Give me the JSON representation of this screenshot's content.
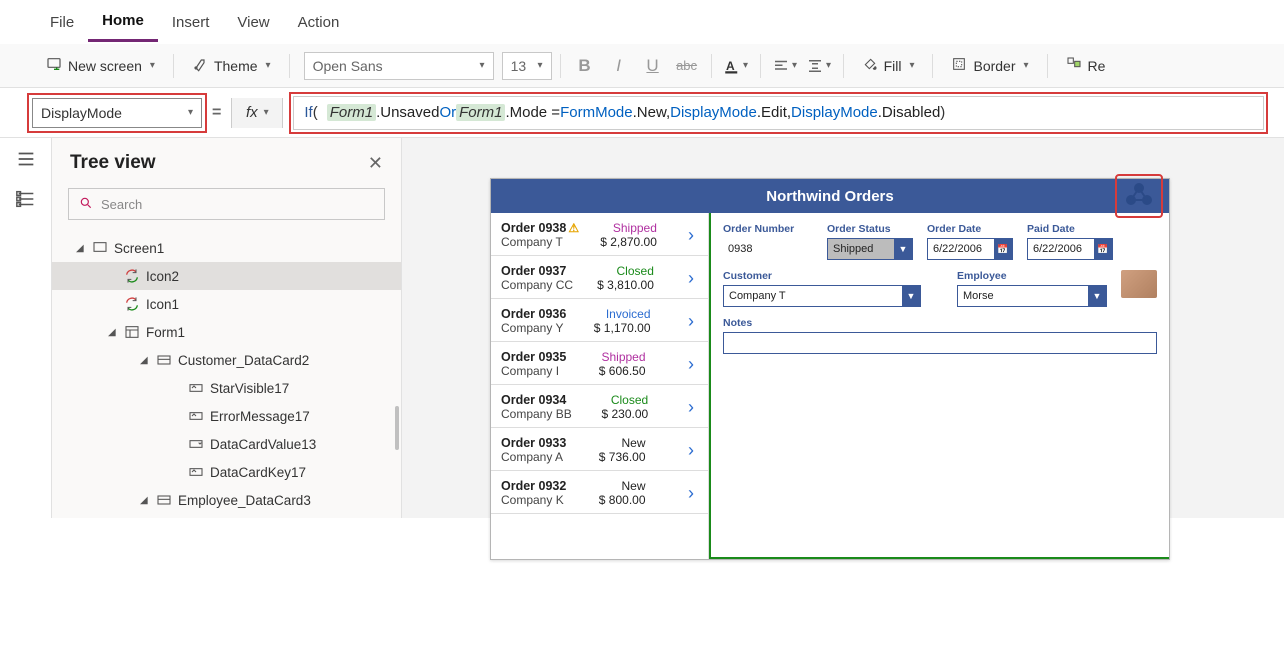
{
  "menu": {
    "items": [
      "File",
      "Home",
      "Insert",
      "View",
      "Action"
    ],
    "active": "Home"
  },
  "ribbon": {
    "new_screen": "New screen",
    "theme": "Theme",
    "font_name": "Open Sans",
    "font_size": "13",
    "fill": "Fill",
    "border": "Border",
    "reorder": "Re"
  },
  "formula": {
    "property": "DisplayMode",
    "fx": "fx",
    "tokens": {
      "if": "If",
      "p1": "(",
      "form1a": "Form1",
      "dot1": ".Unsaved ",
      "or": "Or",
      "sp1": " ",
      "form1b": "Form1",
      "dot2": ".Mode = ",
      "fmode": "FormMode",
      "dot3": ".New, ",
      "dmode1": "DisplayMode",
      "dot4": ".Edit, ",
      "dmode2": "DisplayMode",
      "dot5": ".Disabled ",
      "p2": ")"
    }
  },
  "tree": {
    "title": "Tree view",
    "search_placeholder": "Search",
    "nodes": {
      "screen1": "Screen1",
      "icon2": "Icon2",
      "icon1": "Icon1",
      "form1": "Form1",
      "cust_card": "Customer_DataCard2",
      "starvis": "StarVisible17",
      "errmsg": "ErrorMessage17",
      "dcv": "DataCardValue13",
      "dck": "DataCardKey17",
      "emp_card": "Employee_DataCard3"
    }
  },
  "app": {
    "title": "Northwind Orders",
    "orders": [
      {
        "num": "Order 0938",
        "warn": true,
        "company": "Company T",
        "status": "Shipped",
        "status_cls": "stat-shipped",
        "amount": "$ 2,870.00"
      },
      {
        "num": "Order 0937",
        "company": "Company CC",
        "status": "Closed",
        "status_cls": "stat-closed",
        "amount": "$ 3,810.00"
      },
      {
        "num": "Order 0936",
        "company": "Company Y",
        "status": "Invoiced",
        "status_cls": "stat-invoiced",
        "amount": "$ 1,170.00"
      },
      {
        "num": "Order 0935",
        "company": "Company I",
        "status": "Shipped",
        "status_cls": "stat-shipped",
        "amount": "$ 606.50"
      },
      {
        "num": "Order 0934",
        "company": "Company BB",
        "status": "Closed",
        "status_cls": "stat-closed",
        "amount": "$ 230.00"
      },
      {
        "num": "Order 0933",
        "company": "Company A",
        "status": "New",
        "status_cls": "stat-new",
        "amount": "$ 736.00"
      },
      {
        "num": "Order 0932",
        "company": "Company K",
        "status": "New",
        "status_cls": "stat-new",
        "amount": "$ 800.00"
      }
    ],
    "form": {
      "labels": {
        "order_no": "Order Number",
        "order_status": "Order Status",
        "order_date": "Order Date",
        "paid_date": "Paid Date",
        "customer": "Customer",
        "employee": "Employee",
        "notes": "Notes"
      },
      "values": {
        "order_no": "0938",
        "order_status": "Shipped",
        "order_date": "6/22/2006",
        "paid_date": "6/22/2006",
        "customer": "Company T",
        "employee": "Morse"
      }
    }
  }
}
